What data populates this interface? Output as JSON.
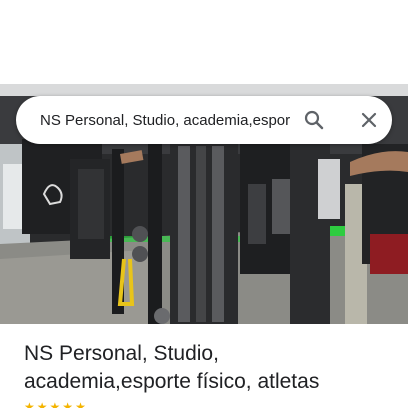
{
  "search": {
    "value": "NS Personal, Studio, academia,esporte físico, atletas",
    "icon": "search-icon",
    "close_icon": "close-icon"
  },
  "place": {
    "title_line1": "NS Personal, Studio,",
    "title_line2": "academia,esporte físico, atletas"
  },
  "colors": {
    "accent_green": "#2ecc40",
    "rating_star": "#f4b400"
  }
}
